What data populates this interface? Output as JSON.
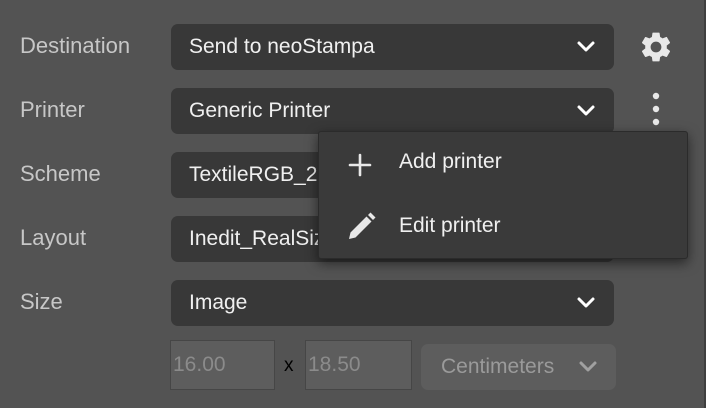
{
  "form": {
    "destination": {
      "label": "Destination",
      "value": "Send to neoStampa"
    },
    "printer": {
      "label": "Printer",
      "value": "Generic Printer"
    },
    "scheme": {
      "label": "Scheme",
      "value": "TextileRGB_2"
    },
    "layout": {
      "label": "Layout",
      "value": "Inedit_RealSiz"
    },
    "size": {
      "label": "Size",
      "value": "Image"
    },
    "dimensions": {
      "width": "16.00",
      "separator": "x",
      "height": "18.50",
      "units": "Centimeters"
    }
  },
  "printer_menu": {
    "items": [
      {
        "label": "Add printer",
        "icon": "plus-icon"
      },
      {
        "label": "Edit printer",
        "icon": "pencil-icon"
      }
    ]
  },
  "icons": {
    "settings": "gear-icon",
    "more": "kebab-menu-icon",
    "dropdown": "chevron-down-icon"
  },
  "colors": {
    "panel_background": "#535353",
    "field_background": "#383838",
    "menu_background": "#3a3a3a",
    "text_primary": "#f0f0f0",
    "text_label": "#c7c7c7",
    "text_disabled": "#8b8b8b"
  }
}
